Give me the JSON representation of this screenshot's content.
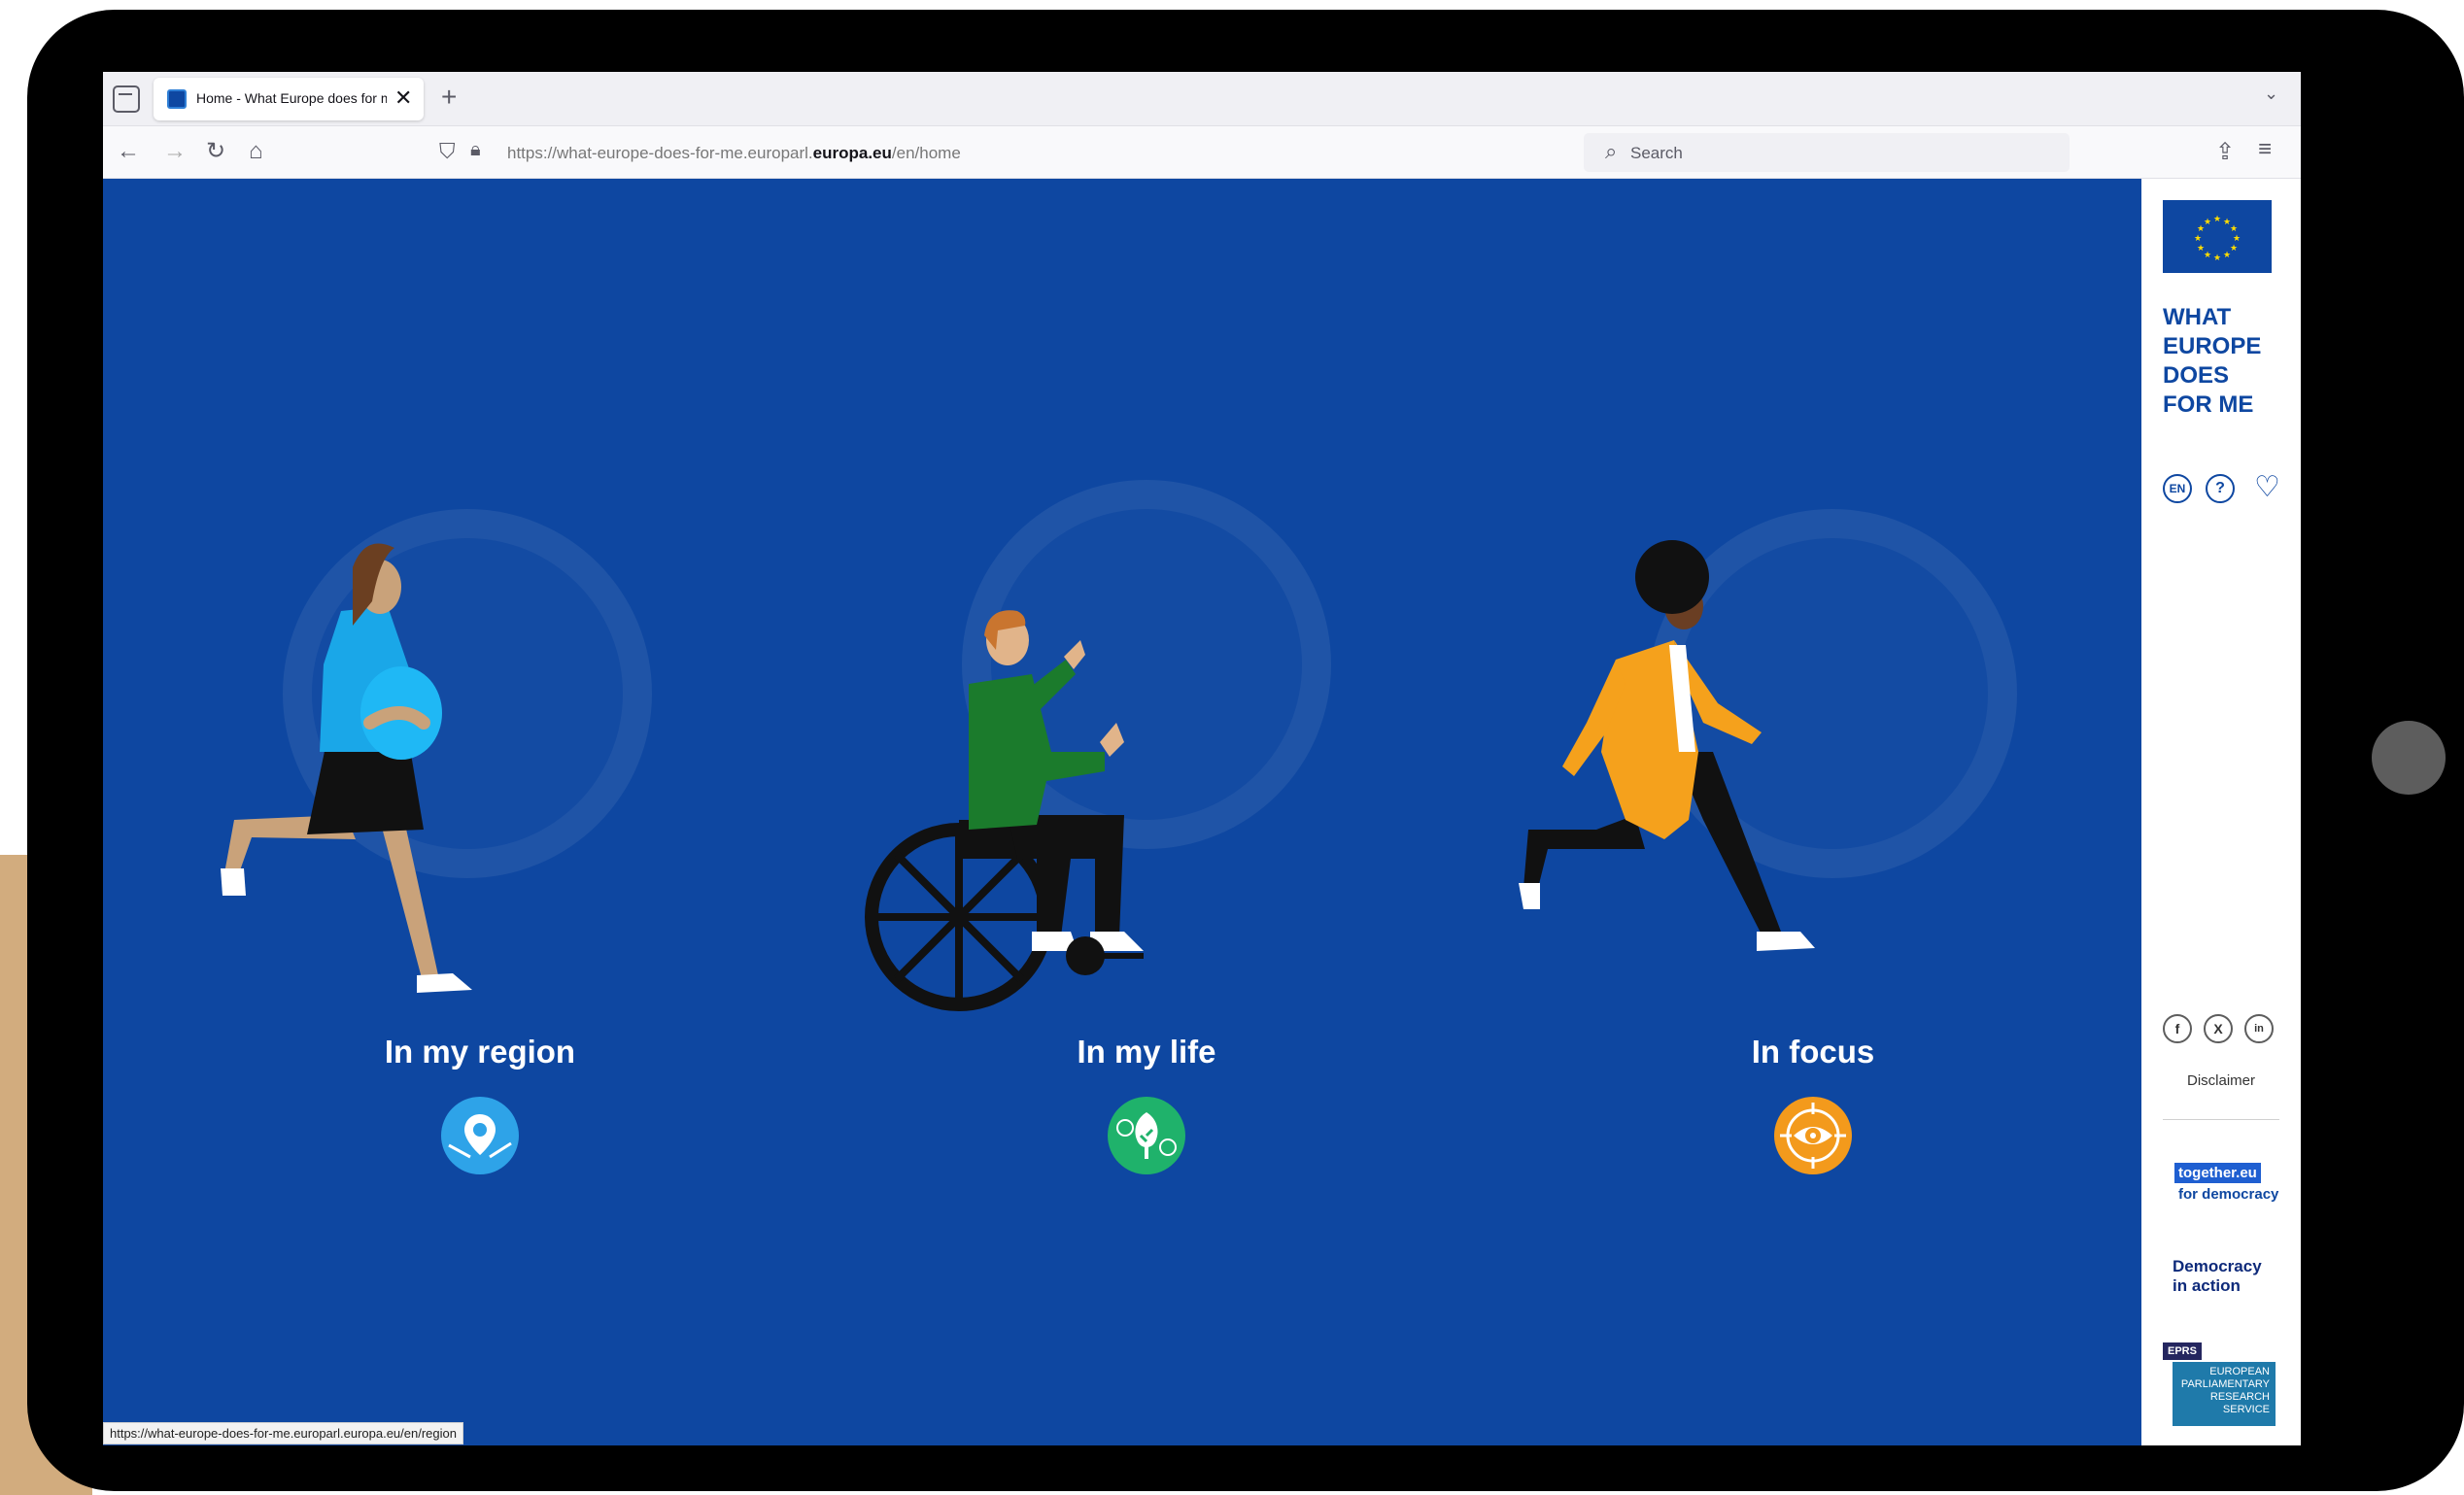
{
  "browser": {
    "tab_title": "Home - What Europe does for me",
    "tab_close": "✕",
    "new_tab": "+",
    "url_prefix": "https://what-europe-does-for-me.europarl.",
    "url_domain": "europa.eu",
    "url_path": "/en/home",
    "search_placeholder": "Search",
    "status_url": "https://what-europe-does-for-me.europarl.europa.eu/en/region"
  },
  "panels": [
    {
      "label": "In my region",
      "icon": "map-pin-icon",
      "icon_color": "#2ea3e8"
    },
    {
      "label": "In my life",
      "icon": "tree-icon",
      "icon_color": "#1fb26b"
    },
    {
      "label": "In focus",
      "icon": "eye-target-icon",
      "icon_color": "#f39a1c"
    }
  ],
  "sidebar": {
    "brand_lines": [
      "WHAT",
      "EUROPE",
      "DOES",
      "FOR ME"
    ],
    "language": "EN",
    "disclaimer": "Disclaimer",
    "social": [
      "f",
      "X",
      "in"
    ],
    "together_top": "together.eu",
    "together_bottom": "for democracy",
    "democracy_line1": "Democracy",
    "democracy_line2": "in action",
    "eprs_tag": "EPRS",
    "eprs_lines": [
      "EUROPEAN",
      "PARLIAMENTARY",
      "RESEARCH",
      "SERVICE"
    ]
  },
  "colors": {
    "main_blue": "#0e47a1",
    "region_icon": "#2ea3e8",
    "life_icon": "#1fb26b",
    "focus_icon": "#f39a1c"
  }
}
